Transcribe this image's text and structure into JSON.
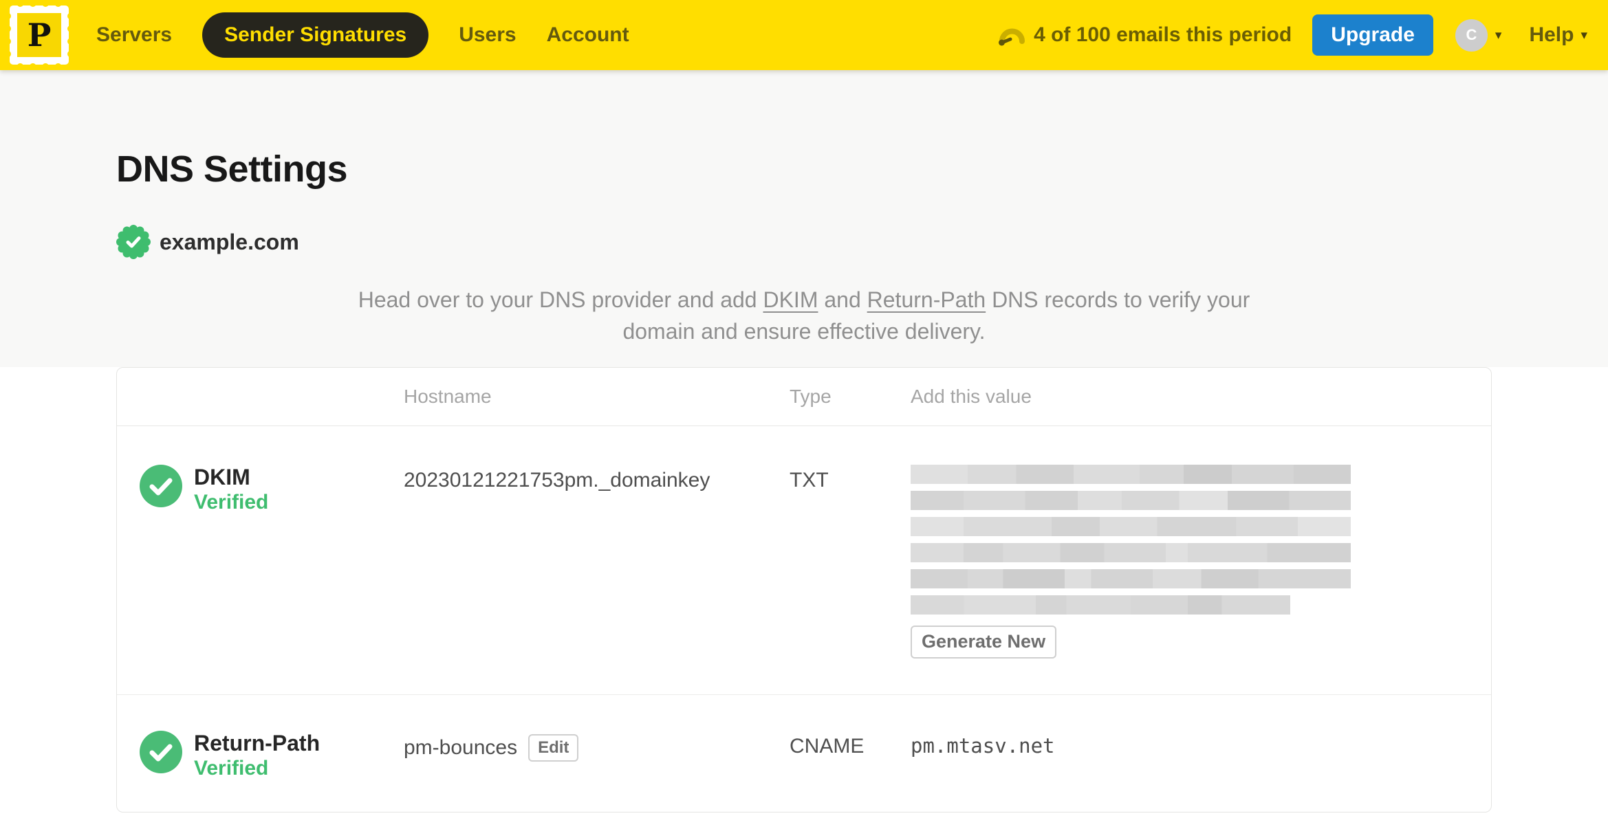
{
  "navbar": {
    "logo_letter": "P",
    "items": [
      {
        "label": "Servers",
        "active": false
      },
      {
        "label": "Sender Signatures",
        "active": true
      },
      {
        "label": "Users",
        "active": false
      },
      {
        "label": "Account",
        "active": false
      }
    ],
    "usage_text": "4 of 100 emails this period",
    "upgrade_label": "Upgrade",
    "avatar_initial": "C",
    "help_label": "Help"
  },
  "page": {
    "title": "DNS Settings",
    "domain": "example.com",
    "description": {
      "before": "Head over to your DNS provider and add ",
      "link_dkim": "DKIM",
      "middle": " and ",
      "link_return_path": "Return-Path",
      "after": " DNS records to verify your domain and ensure effective delivery."
    }
  },
  "table": {
    "headers": {
      "hostname": "Hostname",
      "type": "Type",
      "value": "Add this value"
    },
    "rows": [
      {
        "name": "DKIM",
        "status": "Verified",
        "hostname": "20230121221753pm._domainkey",
        "type": "TXT",
        "value": "(redacted)",
        "action_label": "Generate New"
      },
      {
        "name": "Return-Path",
        "status": "Verified",
        "hostname": "pm-bounces",
        "edit_label": "Edit",
        "type": "CNAME",
        "value": "pm.mtasv.net"
      }
    ]
  },
  "colors": {
    "brand_yellow": "#ffde00",
    "upgrade_blue": "#1c81cd",
    "verified_green": "#3fbd6f",
    "nav_text": "#645a0e"
  }
}
